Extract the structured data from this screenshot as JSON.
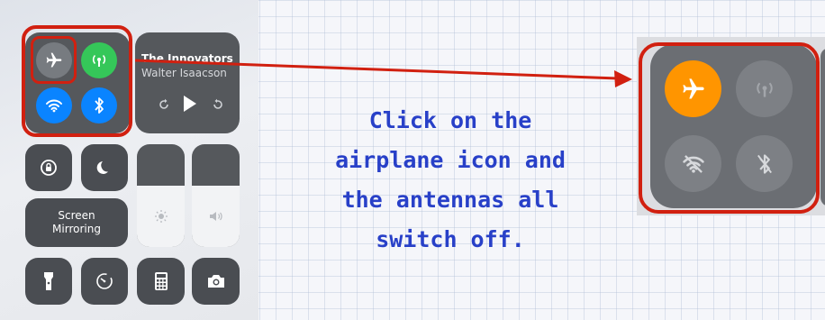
{
  "now_playing": {
    "title": "The Innovators",
    "artist": "Walter Isaacson"
  },
  "screen_mirroring": {
    "line1": "Screen",
    "line2": "Mirroring"
  },
  "caption": {
    "line1": "Click on the",
    "line2": "airplane icon and",
    "line3": "the antennas all",
    "line4": "switch off."
  },
  "colors": {
    "highlight": "#d12010",
    "caption_text": "#2840c8",
    "airplane_active": "#ff9500",
    "cellular_active": "#35c759",
    "wifi_bluetooth_active": "#0a84ff"
  },
  "icons": [
    "airplane-icon",
    "cellular-icon",
    "wifi-icon",
    "bluetooth-icon",
    "rewind-icon",
    "play-icon",
    "forward-icon",
    "orientation-lock-icon",
    "moon-icon",
    "brightness-icon",
    "volume-icon",
    "flashlight-icon",
    "timer-icon",
    "calculator-icon",
    "camera-icon"
  ]
}
